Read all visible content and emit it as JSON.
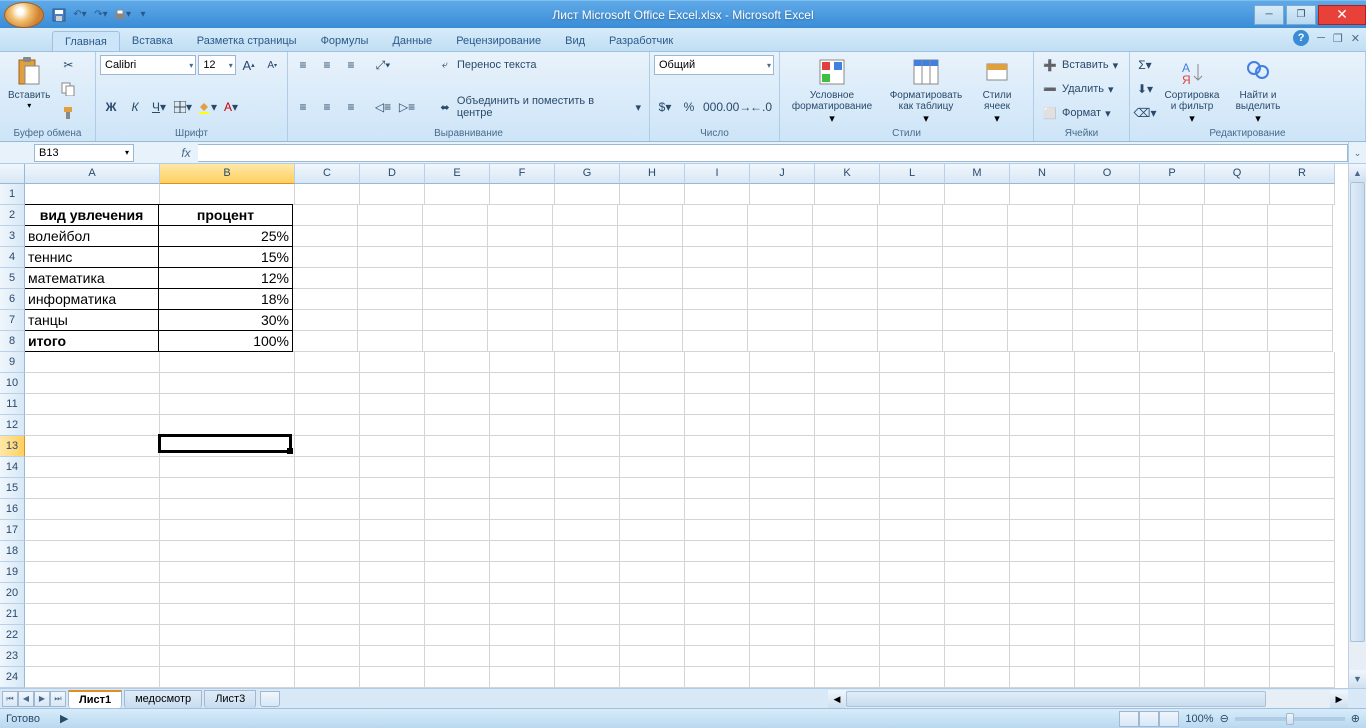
{
  "title": "Лист Microsoft Office Excel.xlsx - Microsoft Excel",
  "tabs": [
    "Главная",
    "Вставка",
    "Разметка страницы",
    "Формулы",
    "Данные",
    "Рецензирование",
    "Вид",
    "Разработчик"
  ],
  "activeTab": "Главная",
  "ribbon": {
    "clipboard": {
      "label": "Буфер обмена",
      "paste": "Вставить"
    },
    "font": {
      "label": "Шрифт",
      "name": "Calibri",
      "size": "12"
    },
    "align": {
      "label": "Выравнивание",
      "wrap": "Перенос текста",
      "merge": "Объединить и поместить в центре"
    },
    "number": {
      "label": "Число",
      "format": "Общий"
    },
    "styles": {
      "label": "Стили",
      "cond": "Условное\nформатирование",
      "table": "Форматировать\nкак таблицу",
      "cell": "Стили\nячеек"
    },
    "cells": {
      "label": "Ячейки",
      "insert": "Вставить",
      "delete": "Удалить",
      "format": "Формат"
    },
    "edit": {
      "label": "Редактирование",
      "sort": "Сортировка\nи фильтр",
      "find": "Найти и\nвыделить"
    }
  },
  "nameBox": "B13",
  "columns": [
    "A",
    "B",
    "C",
    "D",
    "E",
    "F",
    "G",
    "H",
    "I",
    "J",
    "K",
    "L",
    "M",
    "N",
    "O",
    "P",
    "Q",
    "R"
  ],
  "colWidths": {
    "A": 135,
    "B": 135,
    "default": 65
  },
  "selectedCol": "B",
  "selectedRow": 13,
  "rowCount": 24,
  "tableData": {
    "headers": [
      "вид увлечения",
      "процент"
    ],
    "rows": [
      [
        "волейбол",
        "25%"
      ],
      [
        "теннис",
        "15%"
      ],
      [
        "математика",
        "12%"
      ],
      [
        "информатика",
        "18%"
      ],
      [
        "танцы",
        "30%"
      ],
      [
        "итого",
        "100%"
      ]
    ]
  },
  "sheets": [
    "Лист1",
    "медосмотр",
    "Лист3"
  ],
  "activeSheet": "Лист1",
  "status": "Готово",
  "zoom": "100%"
}
